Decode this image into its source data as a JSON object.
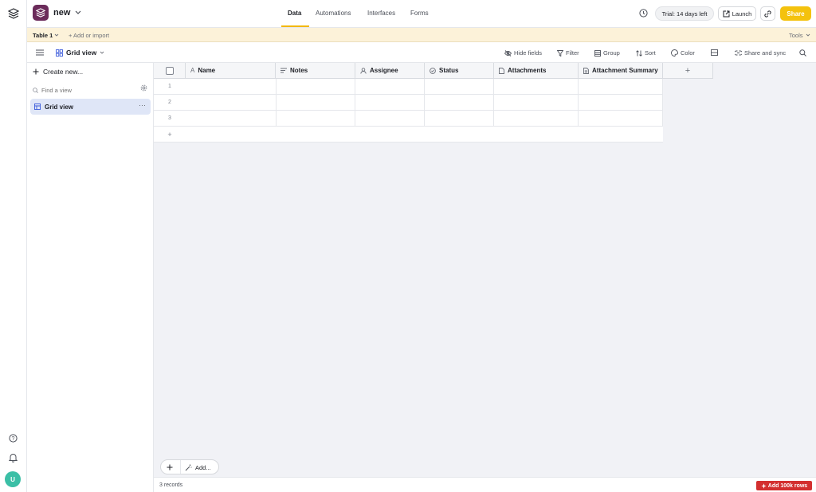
{
  "app": {
    "base_name": "new"
  },
  "top_tabs": [
    {
      "label": "Data",
      "active": true
    },
    {
      "label": "Automations",
      "active": false
    },
    {
      "label": "Interfaces",
      "active": false
    },
    {
      "label": "Forms",
      "active": false
    }
  ],
  "top_right": {
    "trial": "Trial: 14 days left",
    "launch": "Launch",
    "share": "Share"
  },
  "table_bar": {
    "table_name": "Table 1",
    "add_or_import": "+ Add or import",
    "tools": "Tools"
  },
  "view_bar": {
    "view_name": "Grid view",
    "tools": {
      "hide_fields": "Hide fields",
      "filter": "Filter",
      "group": "Group",
      "sort": "Sort",
      "color": "Color",
      "share_sync": "Share and sync"
    }
  },
  "sidebar": {
    "create_new": "Create new...",
    "find_view_placeholder": "Find a view",
    "views": [
      {
        "label": "Grid view",
        "selected": true
      }
    ]
  },
  "grid": {
    "columns": [
      {
        "label": "Name",
        "icon": "text-icon"
      },
      {
        "label": "Notes",
        "icon": "long-text-icon"
      },
      {
        "label": "Assignee",
        "icon": "user-icon"
      },
      {
        "label": "Status",
        "icon": "status-icon"
      },
      {
        "label": "Attachments",
        "icon": "file-icon"
      },
      {
        "label": "Attachment Summary",
        "icon": "doc-icon"
      }
    ],
    "rows": [
      "1",
      "2",
      "3"
    ],
    "add_row": "+",
    "add_column": "+"
  },
  "bottom": {
    "add_label": "Add...",
    "records": "3 records",
    "add_rows": "Add 100k rows"
  },
  "rail": {
    "avatar_initial": "U"
  },
  "colors": {
    "accent": "#f4c20d",
    "brand": "#6b2b5a",
    "selected_view": "#dfe6f7",
    "danger": "#d32f2f"
  }
}
